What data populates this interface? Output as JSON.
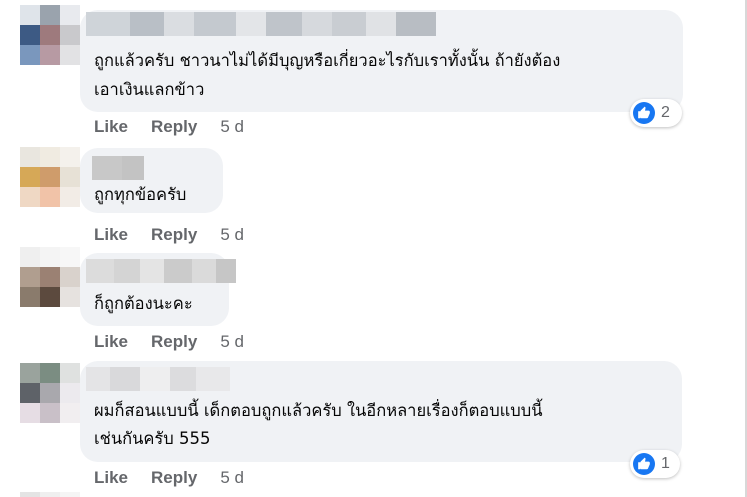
{
  "comments": [
    {
      "text_lines": [
        "ถูกแล้วครับ ชาวนาไม่ได้มีบุญหรือเกี่ยวอะไรกับเราทั้งนั้น ถ้ายังต้อง",
        "เอาเงินแลกข้าว"
      ],
      "actions": {
        "like": "Like",
        "reply": "Reply",
        "time": "5 d"
      },
      "reaction": {
        "icon": "thumbs-up-icon",
        "count": "2"
      },
      "avatar_colors": [
        "#dfe4ea",
        "#9aa3ad",
        "#e8eaee",
        "#3d5a84",
        "#9e7a7d",
        "#c9c9cc",
        "#7a97bd",
        "#b79aa3",
        "#e2e2e4"
      ],
      "name_colors": [
        "#cfd4d9",
        "#b9bfc6",
        "#dadde1",
        "#c4c9cf",
        "#e3e5e8",
        "#bfc4ca",
        "#d6d9dd",
        "#c9cdd2",
        "#e0e2e5",
        "#b8bdc3"
      ]
    },
    {
      "text_lines": [
        "ถูกทุกข้อครับ"
      ],
      "actions": {
        "like": "Like",
        "reply": "Reply",
        "time": "5 d"
      },
      "reaction": null,
      "avatar_colors": [
        "#e9e6df",
        "#f0ebe1",
        "#f4f1ec",
        "#d6a857",
        "#cf9c6b",
        "#e7e1d6",
        "#efd8c4",
        "#f1c3a8",
        "#f2ece6"
      ],
      "name_colors": [
        "#c8c8c8",
        "#c3c3c3"
      ]
    },
    {
      "text_lines": [
        "ก็ถูกต้องนะคะ"
      ],
      "actions": {
        "like": "Like",
        "reply": "Reply",
        "time": "5 d"
      },
      "reaction": null,
      "avatar_colors": [
        "#efefef",
        "#f4f4f4",
        "#f7f7f7",
        "#b09e8f",
        "#9b8173",
        "#d9d2cc",
        "#8a7b6c",
        "#5c4a3e",
        "#e6e2df"
      ],
      "name_colors": [
        "#dcdcdc",
        "#d4d4d4",
        "#e4e4e4",
        "#cbcbcb",
        "#dadada",
        "#c6c6c6"
      ]
    },
    {
      "text_lines": [
        "ผมก็สอนแบบนี้ เด็กตอบถูกแล้วครับ ในอีกหลายเรื่องก็ตอบแบบนี้",
        "เช่นกันครับ 555"
      ],
      "actions": {
        "like": "Like",
        "reply": "Reply",
        "time": "5 d"
      },
      "reaction": {
        "icon": "thumbs-up-icon",
        "count": "1"
      },
      "avatar_colors": [
        "#9aa39d",
        "#7b8d82",
        "#dfe1e0",
        "#5e6268",
        "#a9a8ad",
        "#eceaee",
        "#e6dde4",
        "#c9c0c8",
        "#f1eef0"
      ],
      "name_colors": [
        "#e4e4e6",
        "#d9d9db",
        "#eeeeef",
        "#dcdcde",
        "#e8e8ea"
      ]
    }
  ],
  "colors": {
    "bubble_bg": "#f0f2f5",
    "text": "#050505",
    "secondary_text": "#65676b",
    "like_blue": "#1877f2"
  }
}
